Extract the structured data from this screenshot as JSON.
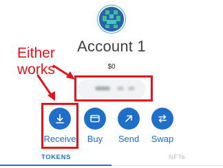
{
  "account": {
    "name": "Account 1",
    "balance": "$0"
  },
  "annotation": {
    "text": "Either works"
  },
  "actions": [
    {
      "label": "Receive",
      "icon": "download-icon"
    },
    {
      "label": "Buy",
      "icon": "credit-card-icon"
    },
    {
      "label": "Send",
      "icon": "arrow-up-right-icon"
    },
    {
      "label": "Swap",
      "icon": "swap-arrows-icon"
    }
  ],
  "tabs": [
    {
      "label": "TOKENS",
      "active": true
    },
    {
      "label": "NFTs",
      "active": false
    }
  ],
  "colors": {
    "accent": "#1e6fc7",
    "annotation": "#e3141b",
    "avatar_ring": "#3bb0c9"
  }
}
